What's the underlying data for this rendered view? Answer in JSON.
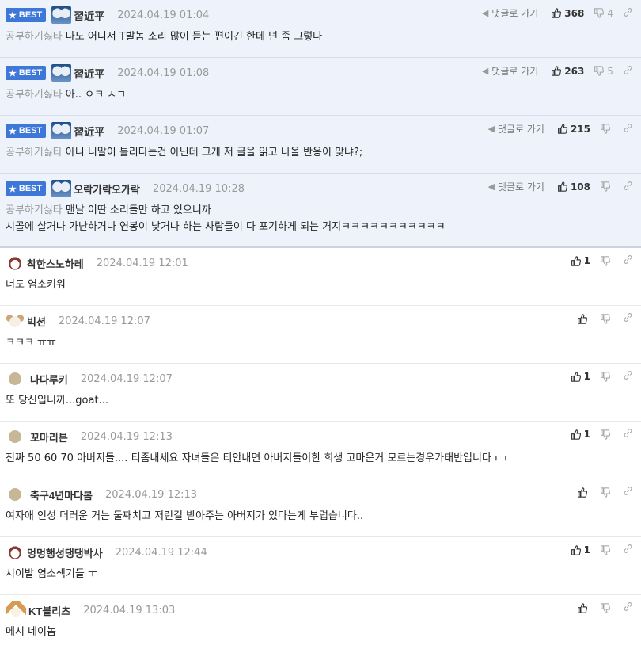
{
  "labels": {
    "best": "BEST",
    "reply": "댓글로 가기"
  },
  "best_comments": [
    {
      "nick": "習近平",
      "date": "2024.04.19 01:04",
      "up": "368",
      "down": "4",
      "author": "공부하기싫타",
      "lines": [
        "나도 어디서 T발놈 소리 많이 듣는 편이긴 한데 넌 좀 그렇다"
      ]
    },
    {
      "nick": "習近平",
      "date": "2024.04.19 01:08",
      "up": "263",
      "down": "5",
      "author": "공부하기싫타",
      "lines": [
        "아.. ㅇㅋ ㅅㄱ"
      ]
    },
    {
      "nick": "習近平",
      "date": "2024.04.19 01:07",
      "up": "215",
      "down": "",
      "author": "공부하기싫타",
      "lines": [
        "아니 니말이 틀리다는건 아닌데 그게 저 글을 읽고 나올 반응이 맞냐?;"
      ]
    },
    {
      "nick": "오락가락오가락",
      "date": "2024.04.19 10:28",
      "up": "108",
      "down": "",
      "author": "공부하기싫타",
      "lines": [
        "맨날 이딴 소리들만 하고 있으니까",
        "시골에 살거나 가난하거나 연봉이 낮거나 하는 사람들이 다 포기하게 되는 거지ㅋㅋㅋㅋㅋㅋㅋㅋㅋㅋㅋ"
      ]
    }
  ],
  "comments": [
    {
      "nick": "착한스노하레",
      "date": "2024.04.19 12:01",
      "up": "1",
      "avatar": "dog",
      "text": "너도 염소키워"
    },
    {
      "nick": "빅션",
      "date": "2024.04.19 12:07",
      "up": "",
      "avatar": "pup",
      "text": "ㅋㅋㅋ ㅠㅠ"
    },
    {
      "nick": "나다루키",
      "date": "2024.04.19 12:07",
      "up": "1",
      "avatar": "dot",
      "text": "또 당신입니까...goat..."
    },
    {
      "nick": "꼬마리븐",
      "date": "2024.04.19 12:13",
      "up": "1",
      "avatar": "dot",
      "text": "진짜 50 60 70 아버지들.... 티좀내세요 자녀들은 티안내면 아버지들이한 희생 고마운거 모르는경우가태반입니다ㅜㅜ"
    },
    {
      "nick": "축구4년마다봄",
      "date": "2024.04.19 12:13",
      "up": "",
      "avatar": "dot",
      "text": "여자애 인성 더러운 거는 둘째치고 저런걸 받아주는 아버지가 있다는게 부럽습니다.."
    },
    {
      "nick": "멍멍행성댕댕박사",
      "date": "2024.04.19 12:44",
      "up": "1",
      "avatar": "dog",
      "text": "시이발 염소색기들 ㅜ"
    },
    {
      "nick": "KT블리츠",
      "date": "2024.04.19 13:03",
      "up": "",
      "avatar": "fox",
      "text": "메시 네이놈"
    }
  ]
}
